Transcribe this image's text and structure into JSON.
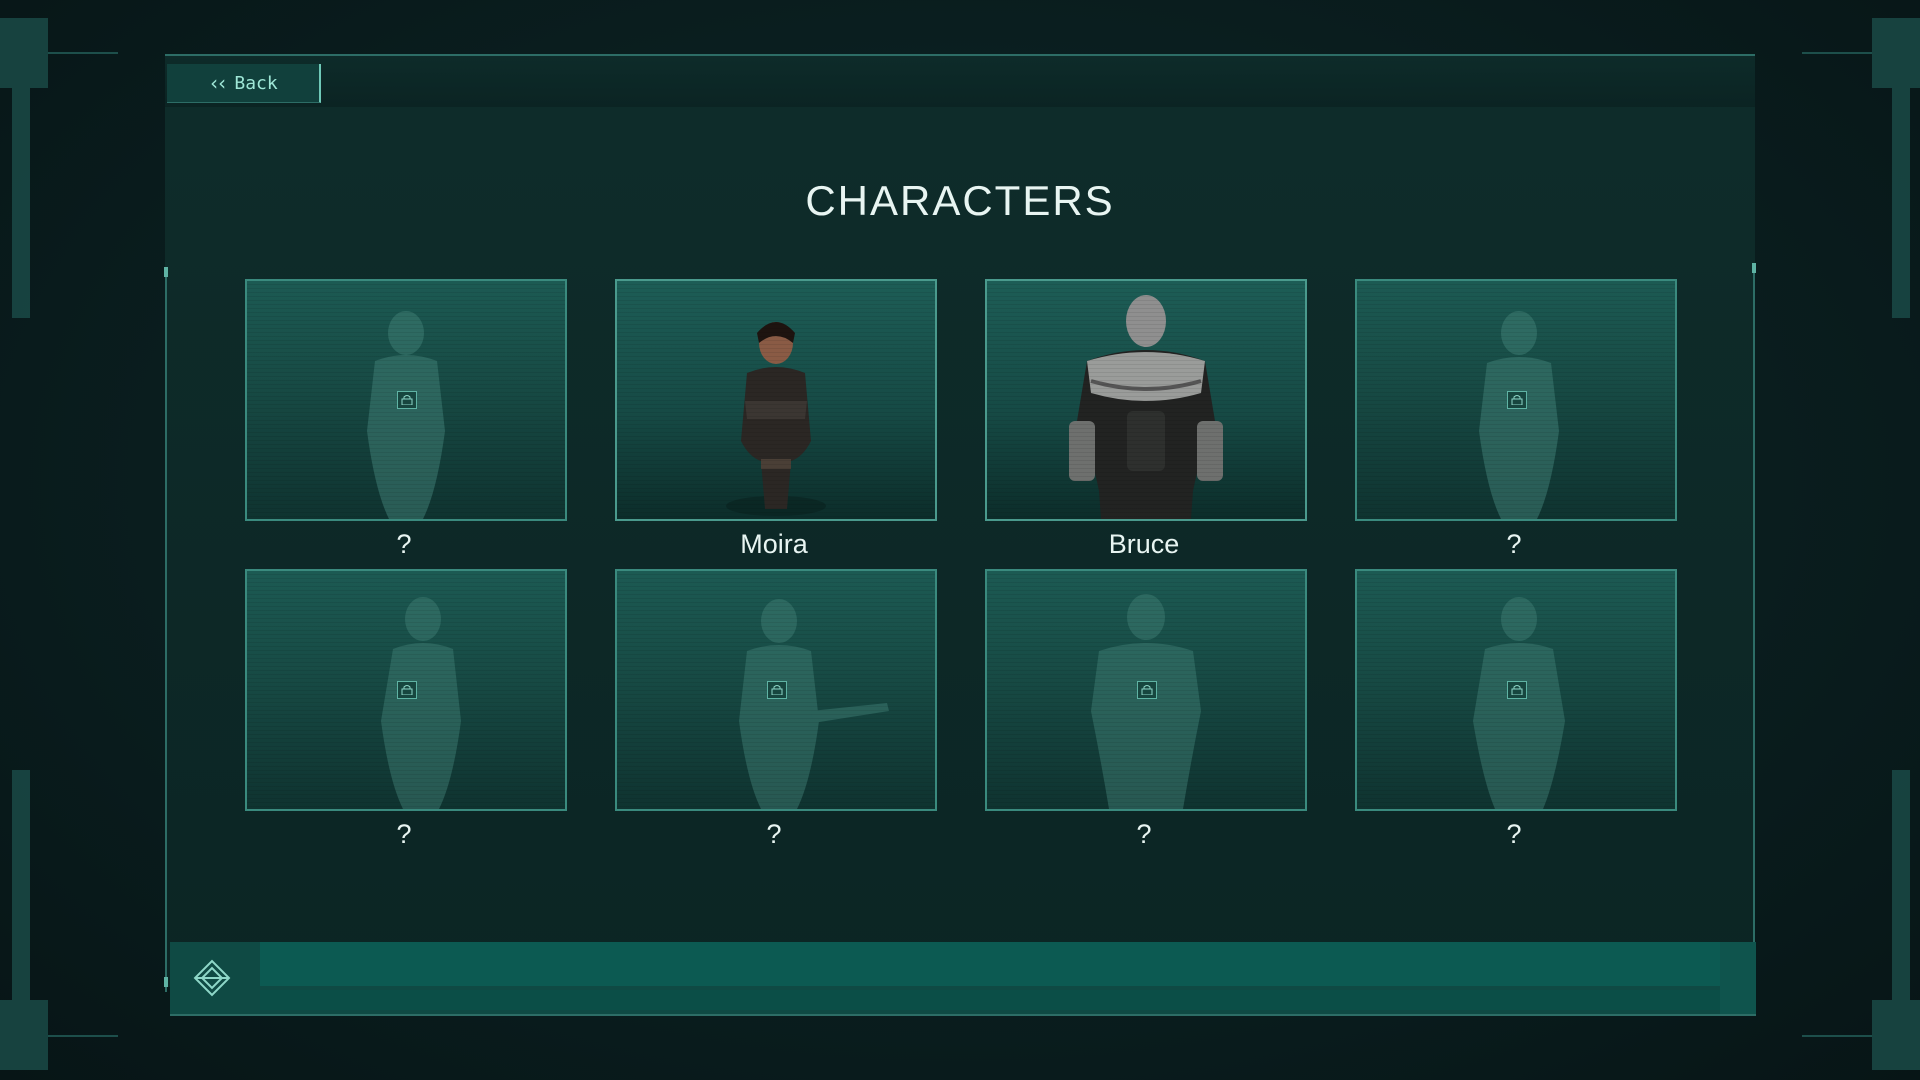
{
  "header": {
    "back_label": "Back",
    "title": "CHARACTERS"
  },
  "characters": [
    {
      "name": "?",
      "locked": true
    },
    {
      "name": "Moira",
      "locked": false
    },
    {
      "name": "Bruce",
      "locked": false
    },
    {
      "name": "?",
      "locked": true
    },
    {
      "name": "?",
      "locked": true
    },
    {
      "name": "?",
      "locked": true
    },
    {
      "name": "?",
      "locked": true
    },
    {
      "name": "?",
      "locked": true
    }
  ],
  "icons": {
    "back": "double-chevron-left-icon",
    "lock": "lock-icon",
    "emblem": "diamond-emblem-icon"
  },
  "colors": {
    "accent": "#3a8a7e",
    "text": "#e8f5f2",
    "panel": "#0e2c2a"
  }
}
